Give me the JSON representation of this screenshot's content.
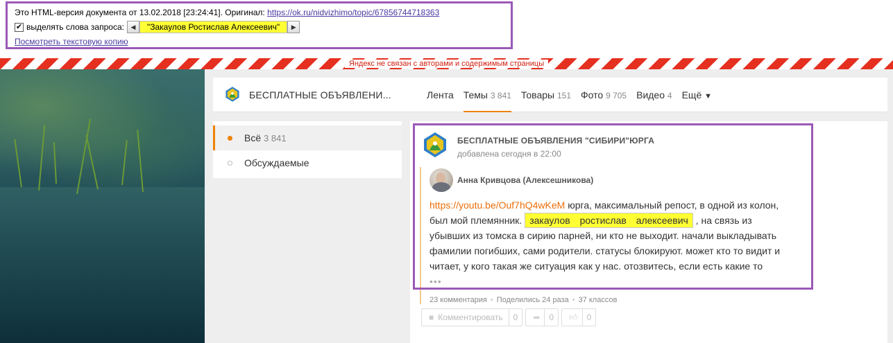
{
  "cache": {
    "notice": "Это HTML-версия документа от 13.02.2018 [23:24:41]. Оригинал: ",
    "original_url": "https://ok.ru/nidvizhimo/topic/67856744718363",
    "highlight_label": "выделять слова запроса:",
    "query_word": "\"Закаулов Ростислав Алексеевич\"",
    "text_copy_link": "Посмотреть текстовую копию"
  },
  "yandex_notice": "Яндекс не связан с авторами и содержимым страницы",
  "group": {
    "name": "БЕСПЛАТНЫЕ ОБЪЯВЛЕНИ...",
    "tabs": [
      {
        "label": "Лента",
        "count": ""
      },
      {
        "label": "Темы",
        "count": "3 841"
      },
      {
        "label": "Товары",
        "count": "151"
      },
      {
        "label": "Фото",
        "count": "9 705"
      },
      {
        "label": "Видео",
        "count": "4"
      },
      {
        "label": "Ещё",
        "count": ""
      }
    ]
  },
  "filters": [
    {
      "label": "Всё",
      "count": "3 841"
    },
    {
      "label": "Обсуждаемые",
      "count": ""
    }
  ],
  "topic": {
    "group_name": "БЕСПЛАТНЫЕ ОБЪЯВЛЕНИЯ \"СИБИРИ\"ЮРГА",
    "date": "добавлена сегодня в 22:00",
    "author": "Анна Кривцова (Алексешникова)",
    "link": "https://youtu.be/Ouf7hQ4wKeM",
    "text_before": " юрга, максимальный репост, в одной из колон, был мой племянник. ",
    "highlight": "закаулов ростислав алексеевич",
    "text_after": " , на связь из убывших из томска в сирию парней, ни кто не выходит. начали выкладывать фамилии погибших, сами родители. статусы блокируют. может кто то видит и читает, у кого такая же ситуация как у нас. отозвитесь, если есть какие то",
    "ellipsis": "•••",
    "stats": {
      "comments": "23 комментария",
      "shared": "Поделились 24 раза",
      "classes": "37 классов"
    },
    "actions": {
      "comment_label": "Комментировать",
      "comment_count": "0",
      "share_count": "0",
      "like_count": "0"
    }
  },
  "colors": {
    "accent": "#ee8208",
    "highlight": "#ffff33",
    "frame": "#9b59b6",
    "link": "#ee6e08"
  }
}
